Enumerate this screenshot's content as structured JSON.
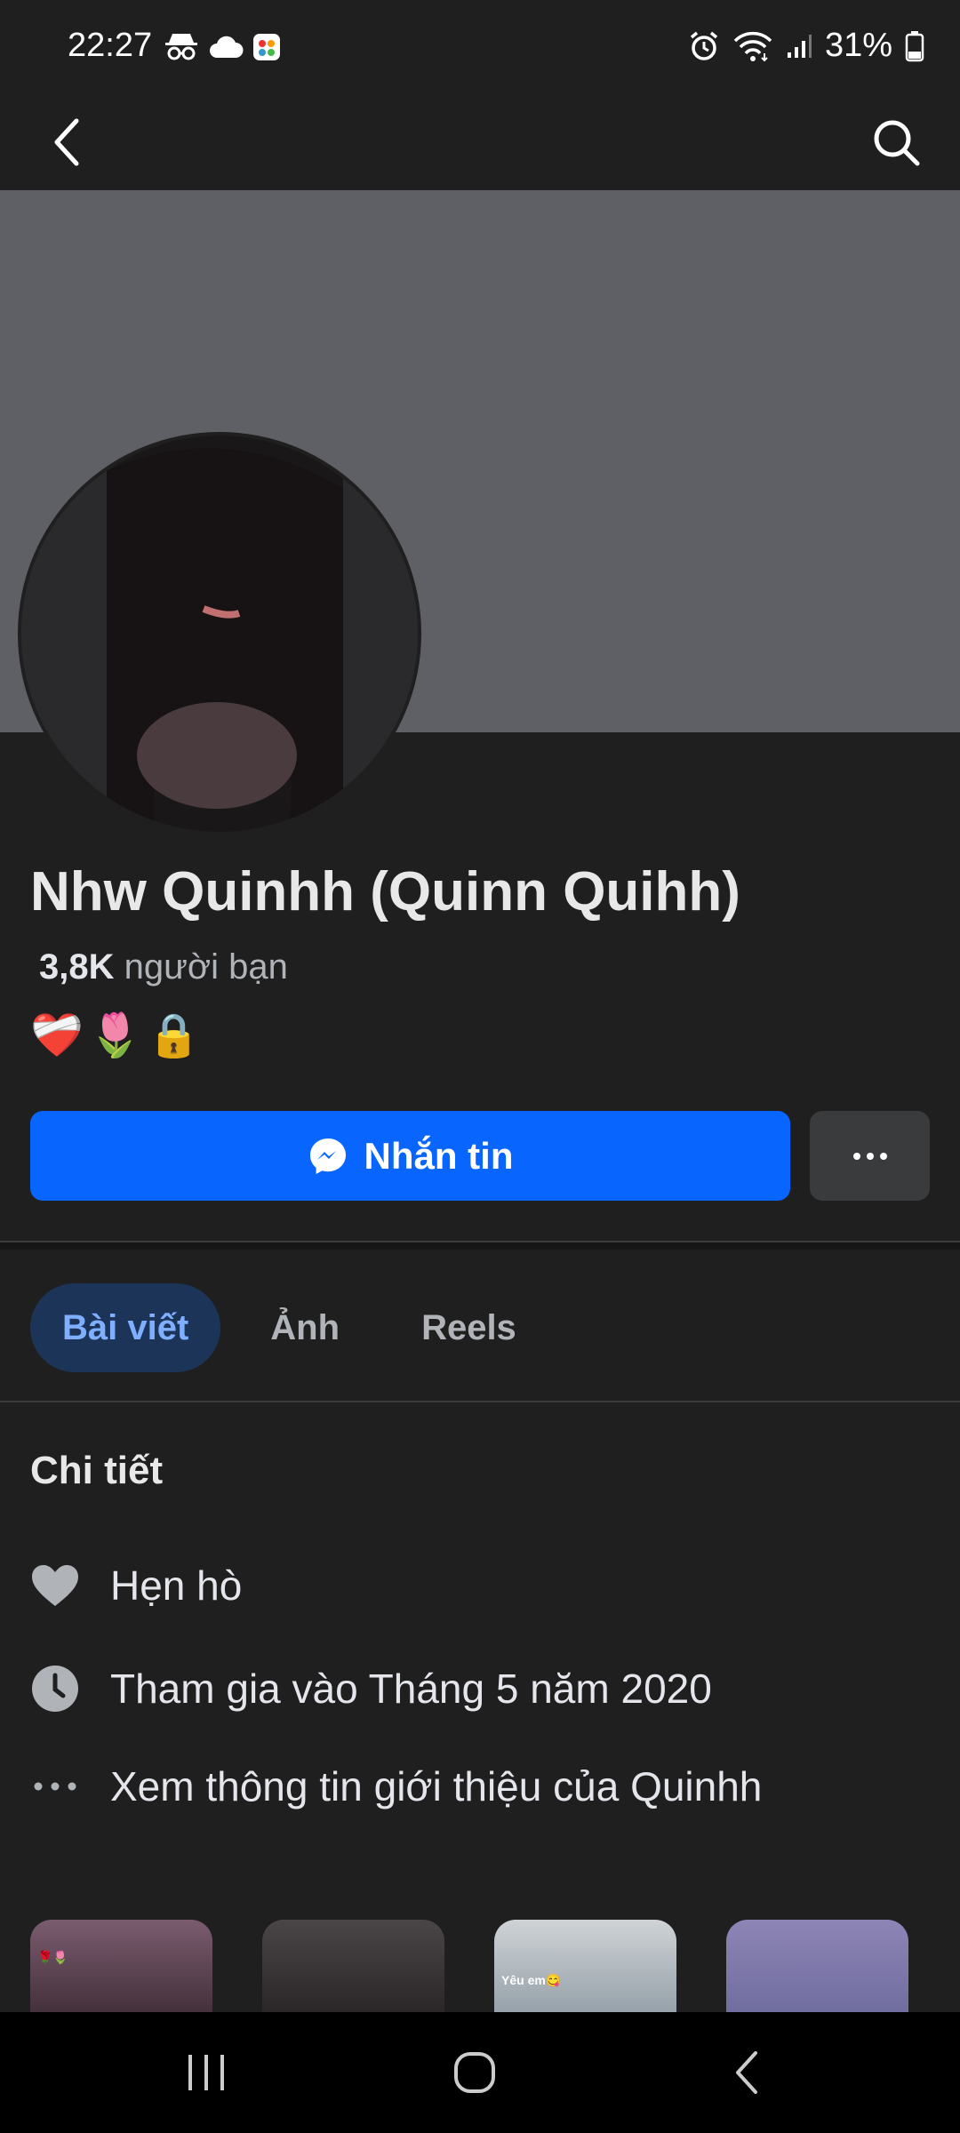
{
  "status_bar": {
    "time": "22:27",
    "battery": "31%",
    "left_icons": [
      "incognito-icon",
      "cloud-icon",
      "app-icon"
    ],
    "right_icons": [
      "alarm-icon",
      "wifi-icon",
      "signal-icon",
      "battery-icon"
    ]
  },
  "header": {
    "back_icon": "back-arrow-icon",
    "search_icon": "search-icon"
  },
  "profile": {
    "name": "Nhw Quinhh (Quinn Quihh)",
    "friends_count": "3,8K",
    "friends_label": "người bạn",
    "bio_emojis": [
      "❤️‍🩹",
      "🌷",
      "🔒"
    ]
  },
  "actions": {
    "message_label": "Nhắn tin",
    "more_label": "···"
  },
  "tabs": [
    {
      "label": "Bài viết",
      "active": true
    },
    {
      "label": "Ảnh",
      "active": false
    },
    {
      "label": "Reels",
      "active": false
    }
  ],
  "details": {
    "title": "Chi tiết",
    "items": [
      {
        "icon": "heart-icon",
        "text": "Hẹn hò"
      },
      {
        "icon": "clock-icon",
        "text": "Tham gia vào Tháng 5 năm 2020"
      },
      {
        "icon": "more-dots-icon",
        "text": "Xem thông tin giới thiệu của Quinhh"
      }
    ]
  },
  "photo_thumbs": [
    {
      "caption": "🌹🌷"
    },
    {
      "caption": ""
    },
    {
      "caption": "Yêu em😋"
    },
    {
      "caption": ""
    }
  ],
  "nav_bar": {
    "buttons": [
      "recents-icon",
      "home-icon",
      "back-icon"
    ]
  }
}
